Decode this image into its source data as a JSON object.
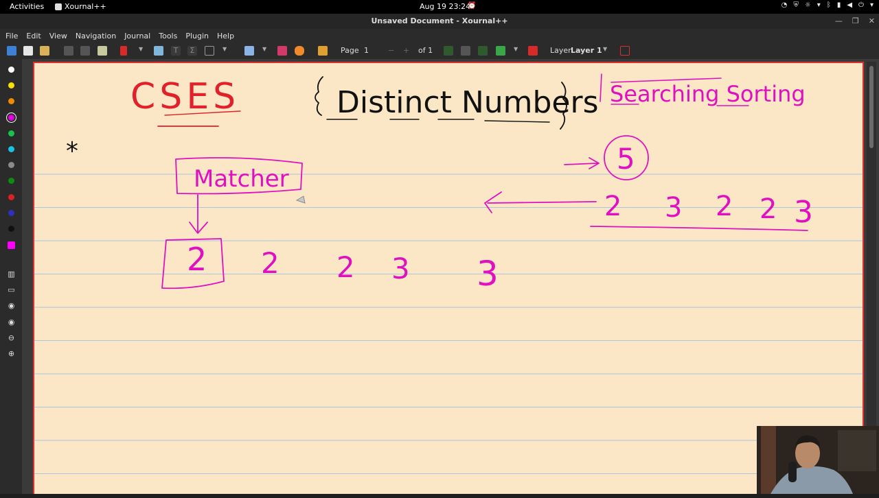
{
  "topbar": {
    "activities": "Activities",
    "app_name": "Xournal++",
    "clock": "Aug 19  23:24"
  },
  "window": {
    "title": "Unsaved Document - Xournal++"
  },
  "menu": {
    "items": [
      "File",
      "Edit",
      "View",
      "Navigation",
      "Journal",
      "Tools",
      "Plugin",
      "Help"
    ]
  },
  "toolbar": {
    "page_label": "Page",
    "page_value": "1",
    "page_of": "of 1",
    "layer_label": "Layer",
    "layer_value": "Layer 1"
  },
  "palette": {
    "colors": [
      "#ffffff",
      "#f5e000",
      "#f08a00",
      "#e000e0",
      "#19c24a",
      "#19c2e0",
      "#8a8a8a",
      "#118a11",
      "#e02020",
      "#3030c0",
      "#111111",
      "#ff00ff"
    ]
  },
  "canvas": {
    "ink_red": "#e0202a",
    "ink_magenta": "#e010c0",
    "ink_black": "#111111",
    "rule_color": "#a9c6da",
    "handwriting": {
      "title_left": "CSES",
      "title_mid": "Distinct Numbers",
      "title_right": "Searching Sorting",
      "asterisk": "*",
      "box_label": "Matcher",
      "circle_value": "5",
      "sequence_top": [
        "2",
        "3",
        "2",
        "2",
        "3"
      ],
      "boxed_value": "2",
      "sequence_bottom": [
        "2",
        "2",
        "3",
        "3"
      ]
    }
  }
}
